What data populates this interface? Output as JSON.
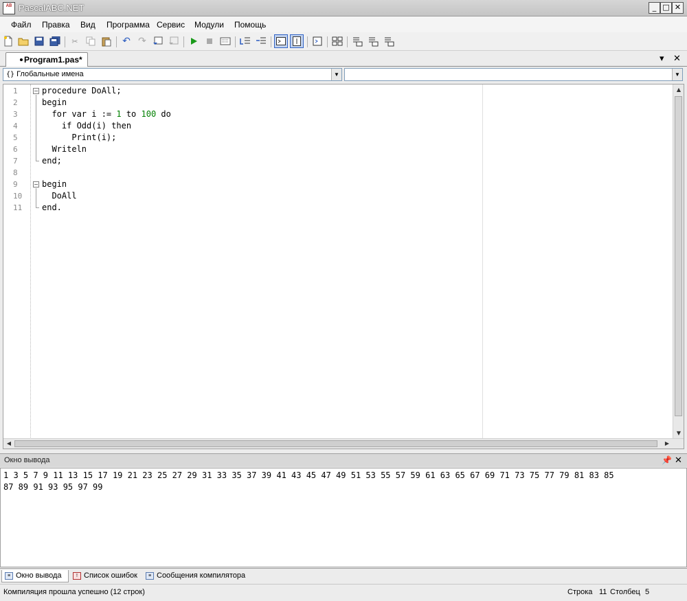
{
  "window": {
    "title": "PascalABC.NET",
    "app_icon_text": "AB"
  },
  "menu": {
    "items": [
      {
        "label": "Файл"
      },
      {
        "label": "Правка"
      },
      {
        "label": "Вид"
      },
      {
        "label": "Программа"
      },
      {
        "label": "Сервис"
      },
      {
        "label": "Модули"
      },
      {
        "label": "Помощь"
      }
    ]
  },
  "toolbar": {
    "buttons": [
      "new-file-icon",
      "open-folder-icon",
      "save-icon",
      "save-all-icon",
      "cut-icon",
      "copy-icon",
      "paste-icon",
      "undo-icon",
      "redo-icon",
      "comment-icon",
      "uncomment-icon",
      "run-icon",
      "stop-icon",
      "compile-icon",
      "step-into-icon",
      "step-over-icon",
      "output-window-icon",
      "design-mode-icon",
      "format-icon",
      "expand-icon",
      "debug-icon",
      "watch-icon",
      "refactor-icon"
    ]
  },
  "tabs": {
    "document": "Program1.pas*"
  },
  "navigation": {
    "left_combo": "Глобальные имена",
    "right_combo": ""
  },
  "editor": {
    "line_numbers": [
      "1",
      "2",
      "3",
      "4",
      "5",
      "6",
      "7",
      "8",
      "9",
      "10",
      "11"
    ],
    "lines": [
      "procedure DoAll;",
      "begin",
      "  for var i := 1 to 100 do",
      "    if Odd(i) then",
      "      Print(i);",
      "  Writeln",
      "end;",
      "",
      "begin",
      "  DoAll",
      "end."
    ]
  },
  "output": {
    "title": "Окно вывода",
    "text": "1 3 5 7 9 11 13 15 17 19 21 23 25 27 29 31 33 35 37 39 41 43 45 47 49 51 53 55 57 59 61 63 65 67 69 71 73 75 77 79 81 83 85\n87 89 91 93 95 97 99"
  },
  "bottom_tabs": [
    {
      "label": "Окно вывода"
    },
    {
      "label": "Список ошибок"
    },
    {
      "label": "Сообщения компилятора"
    }
  ],
  "status": {
    "message": "Компиляция прошла успешно (12 строк)",
    "row_label": "Строка",
    "row_value": "11",
    "col_label": "Столбец",
    "col_value": "5"
  }
}
